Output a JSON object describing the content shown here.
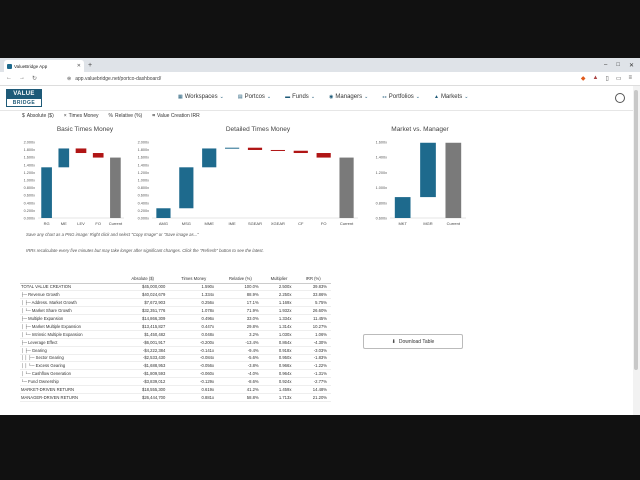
{
  "browser": {
    "tab_title": "ValueBridge App",
    "url": "app.valuebridge.net/portco-dashboard/"
  },
  "app": {
    "logo_top": "VALUE",
    "logo_bottom": "BRIDGE",
    "menu": [
      "Workspaces",
      "Portcos",
      "Funds",
      "Managers",
      "Portfolios",
      "Markets"
    ]
  },
  "toolbar": [
    "Absolute ($)",
    "Times Money",
    "Relative (%)",
    "Value Creation IRR"
  ],
  "colors": {
    "start_end": "#7a7a7a",
    "positive": "#1e6a8d",
    "negative": "#b01515"
  },
  "notes": {
    "save": "Save any chart as a PNG image: Right click and select \"Copy Image\" or \"Save image as...\"",
    "irr": "IRRs recalculate every five minutes but may take longer after significant changes. Click the \"Refresh\" button to see the latest."
  },
  "download_label": "Download Table",
  "chart_data": [
    {
      "type": "bar",
      "title": "Basic Times Money",
      "categories": [
        "RG",
        "ME",
        "LEV",
        "FO",
        "Current"
      ],
      "bars": [
        [
          0,
          1.334
        ],
        [
          1.334,
          1.83
        ],
        [
          1.83,
          1.71
        ],
        [
          1.71,
          1.59
        ],
        [
          0,
          1.59
        ]
      ],
      "ylim": [
        0,
        2.0
      ],
      "yticks": [
        "0.000x",
        "0.200x",
        "0.400x",
        "0.600x",
        "0.800x",
        "1.000x",
        "1.200x",
        "1.400x",
        "1.600x",
        "1.800x",
        "2.000x"
      ]
    },
    {
      "type": "bar",
      "title": "Detailed Times Money",
      "categories": [
        "AMG",
        "MSG",
        "MME",
        "IME",
        "SGEAR",
        "XGEAR",
        "CF",
        "FO",
        "Current"
      ],
      "bars": [
        [
          0,
          0.256
        ],
        [
          0.256,
          1.334
        ],
        [
          1.334,
          1.83
        ],
        [
          1.83,
          1.85
        ],
        [
          1.85,
          1.79
        ],
        [
          1.79,
          1.77
        ],
        [
          1.77,
          1.71
        ],
        [
          1.71,
          1.59
        ],
        [
          0,
          1.59
        ]
      ],
      "ylim": [
        0,
        2.0
      ],
      "yticks": [
        "0.000x",
        "0.200x",
        "0.400x",
        "0.600x",
        "0.800x",
        "1.000x",
        "1.200x",
        "1.400x",
        "1.600x",
        "1.800x",
        "2.000x"
      ]
    },
    {
      "type": "bar",
      "title": "Market vs. Manager",
      "categories": [
        "MKT",
        "MGR",
        "Current"
      ],
      "bars": [
        [
          0.6,
          0.875
        ],
        [
          0.875,
          1.59
        ],
        [
          0.6,
          1.59
        ]
      ],
      "ylim": [
        0.6,
        1.6
      ],
      "yticks": [
        "0.600x",
        "0.800x",
        "1.000x",
        "1.200x",
        "1.400x",
        "1.600x"
      ]
    }
  ],
  "table": {
    "headers": [
      "",
      "Absolute ($)",
      "Times Money",
      "Relative (%)",
      "Multiplier",
      "IRR (%)"
    ],
    "rows": [
      [
        "TOTAL VALUE CREATION",
        "$45,000,000",
        "1.590x",
        "100.0%",
        "2.500x",
        "39.83%"
      ],
      [
        "├─ Revenue Growth",
        "$40,024,679",
        "1.334x",
        "88.9%",
        "2.250x",
        "33.86%"
      ],
      [
        "│   ├─ Address. Market Growth",
        "$7,672,903",
        "0.256x",
        "17.1%",
        "1.169x",
        "5.75%"
      ],
      [
        "│   └─ Market Share Growth",
        "$32,351,776",
        "1.078x",
        "71.9%",
        "1.932x",
        "26.60%"
      ],
      [
        "├─ Multiple Expansion",
        "$14,866,309",
        "0.496x",
        "33.0%",
        "1.334x",
        "11.45%"
      ],
      [
        "│   ├─ Market Multiple Expansion",
        "$13,415,827",
        "0.447x",
        "29.8%",
        "1.314x",
        "10.27%"
      ],
      [
        "│   └─ Intrinsic Multiple Expansion",
        "$1,450,482",
        "0.048x",
        "3.2%",
        "1.030x",
        "1.06%"
      ],
      [
        "├─ Leverage Effect",
        "-$6,001,917",
        "-0.200x",
        "-13.4%",
        "0.864x",
        "-4.30%"
      ],
      [
        "│   ├─ Gearing",
        "-$4,222,384",
        "-0.141x",
        "-9.4%",
        "0.918x",
        "-3.03%"
      ],
      [
        "│   │   ├─ Sector Gearing",
        "-$2,533,430",
        "-0.084x",
        "-5.6%",
        "0.950x",
        "-1.83%"
      ],
      [
        "│   │   └─ Excess Gearing",
        "-$1,688,953",
        "-0.056x",
        "-3.8%",
        "0.966x",
        "-1.22%"
      ],
      [
        "│   └─ Cashflow Generation",
        "-$1,809,593",
        "-0.060x",
        "-4.0%",
        "0.964x",
        "-1.31%"
      ],
      [
        "└─ Fund Ownership",
        "-$3,839,012",
        "-0.129x",
        "-8.6%",
        "0.924x",
        "-2.77%"
      ],
      [
        "MARKET-DRIVEN RETURN",
        "$18,555,300",
        "0.619x",
        "41.2%",
        "1.459x",
        "14.48%"
      ],
      [
        "MANAGER-DRIVEN RETURN",
        "$26,444,700",
        "0.881x",
        "58.8%",
        "1.713x",
        "21.20%"
      ]
    ]
  }
}
